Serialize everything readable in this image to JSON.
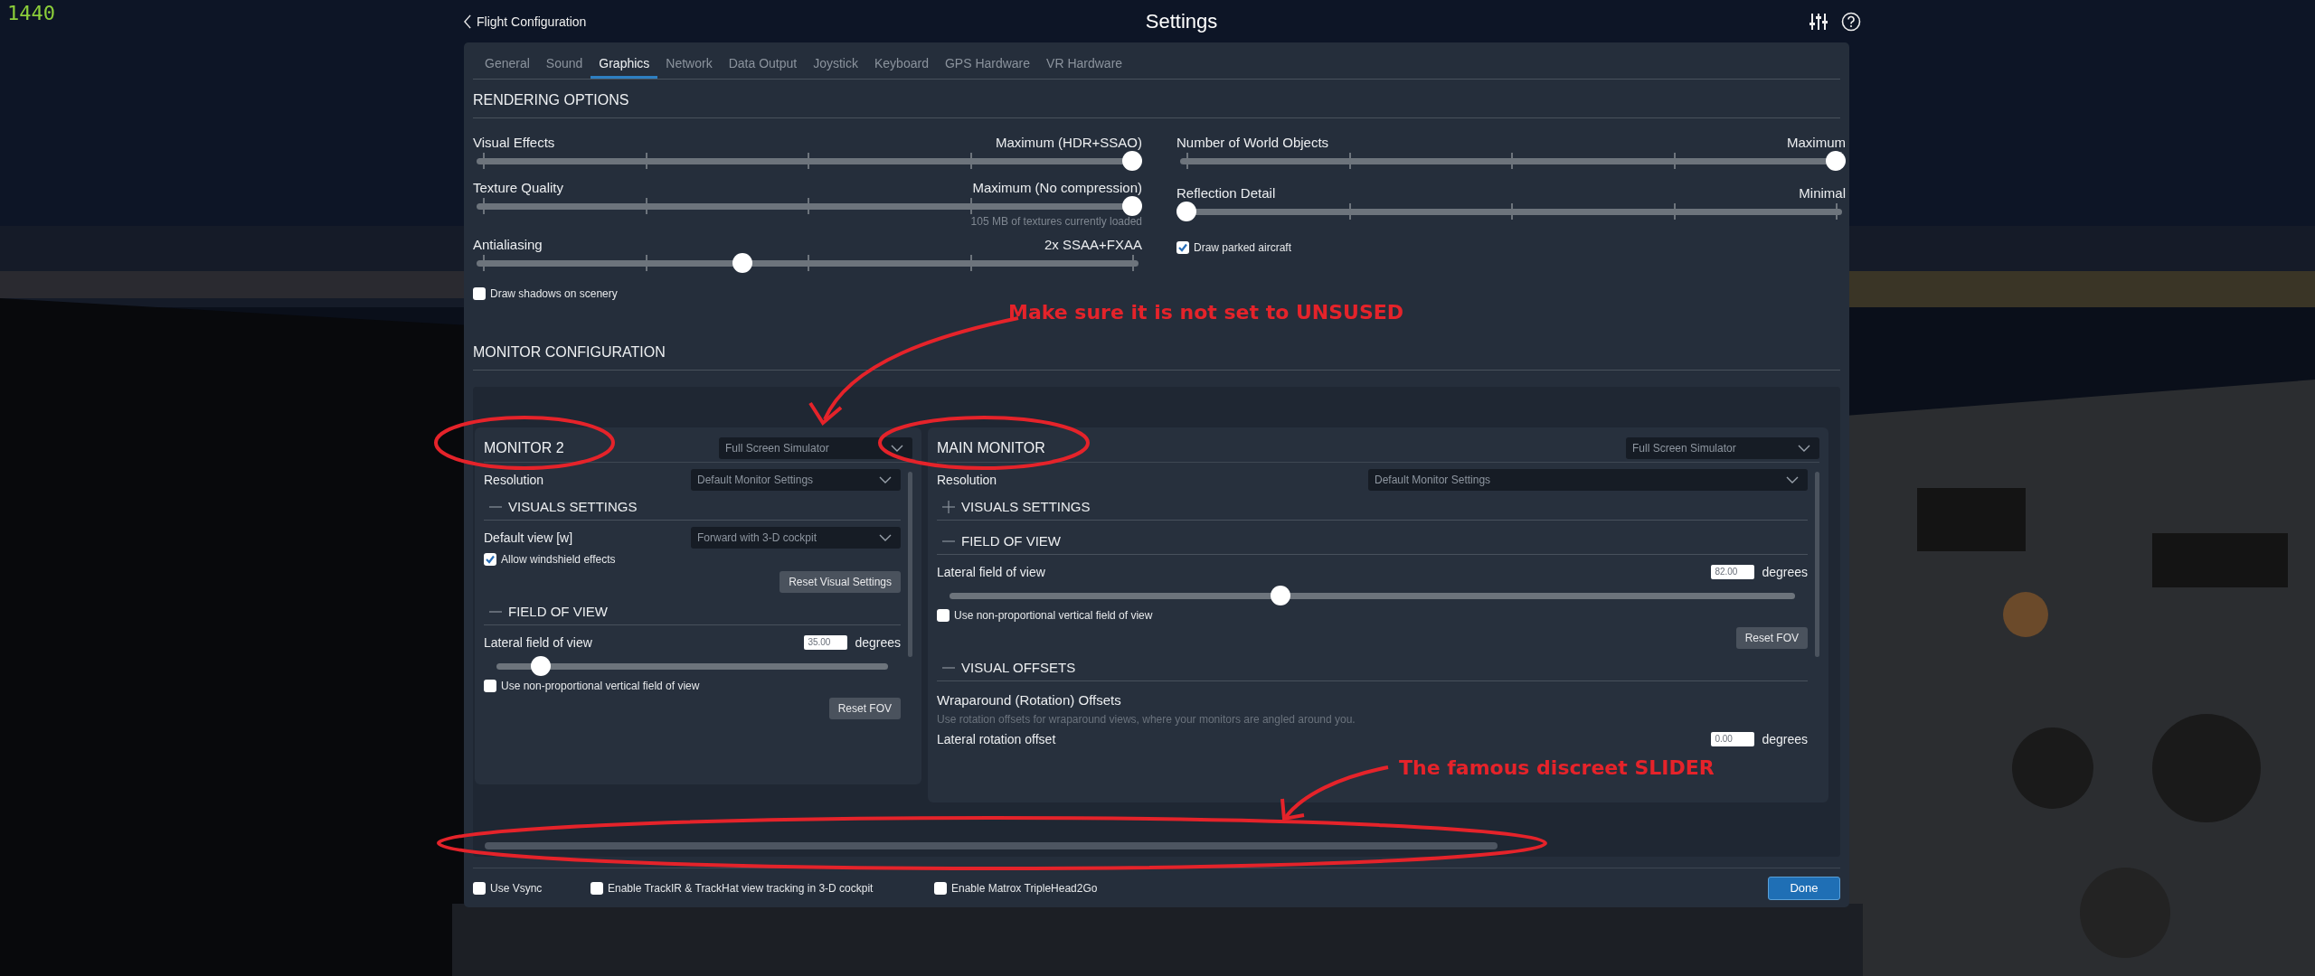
{
  "fps_counter": "1440",
  "header": {
    "back_link": "Flight Configuration",
    "title": "Settings"
  },
  "tabs": [
    {
      "label": "General",
      "selected": false
    },
    {
      "label": "Sound",
      "selected": false
    },
    {
      "label": "Graphics",
      "selected": true
    },
    {
      "label": "Network",
      "selected": false
    },
    {
      "label": "Data Output",
      "selected": false
    },
    {
      "label": "Joystick",
      "selected": false
    },
    {
      "label": "Keyboard",
      "selected": false
    },
    {
      "label": "GPS Hardware",
      "selected": false
    },
    {
      "label": "VR Hardware",
      "selected": false
    }
  ],
  "rendering": {
    "title": "RENDERING OPTIONS",
    "left": [
      {
        "kind": "slider",
        "label": "Visual Effects",
        "value": "Maximum (HDR+SSAO)",
        "level": 1
      },
      {
        "kind": "slider",
        "label": "Texture Quality",
        "value": "Maximum (No compression)",
        "level": 1,
        "note": "105 MB of textures currently loaded"
      },
      {
        "kind": "slider",
        "label": "Antialiasing",
        "value": "2x SSAA+FXAA",
        "level": 0.4
      },
      {
        "kind": "checkbox",
        "label": "Draw shadows on scenery",
        "checked": false
      }
    ],
    "right": [
      {
        "kind": "slider",
        "label": "Number of World Objects",
        "value": "Maximum",
        "level": 1
      },
      {
        "kind": "slider",
        "label": "Reflection Detail",
        "value": "Minimal",
        "level": 0
      },
      {
        "kind": "checkbox",
        "label": "Draw parked aircraft",
        "checked": true
      }
    ]
  },
  "monitor_configuration": {
    "title": "MONITOR CONFIGURATION",
    "monitors": [
      {
        "title": "MONITOR 2",
        "mode": "Full Screen Simulator",
        "items": [
          {
            "kind": "dropdown",
            "label": "Resolution",
            "value": "Default Monitor Settings"
          },
          {
            "kind": "section",
            "label": "VISUALS SETTINGS",
            "expanded": true
          },
          {
            "kind": "dropdown",
            "label": "Default view [w]",
            "value": "Forward with 3-D cockpit"
          },
          {
            "kind": "checkbox",
            "label": "Allow windshield effects",
            "checked": true
          },
          {
            "kind": "button",
            "label": "Reset Visual Settings"
          },
          {
            "kind": "section",
            "label": "FIELD OF VIEW",
            "expanded": true
          },
          {
            "kind": "fov",
            "label": "Lateral field of view",
            "value": "35.00",
            "unit": "degrees",
            "level": 0.1
          },
          {
            "kind": "checkbox",
            "label": "Use non-proportional vertical field of view",
            "checked": false
          },
          {
            "kind": "button",
            "label": "Reset FOV"
          }
        ]
      },
      {
        "title": "MAIN MONITOR",
        "mode": "Full Screen Simulator",
        "items": [
          {
            "kind": "dropdown",
            "label": "Resolution",
            "value": "Default Monitor Settings"
          },
          {
            "kind": "section",
            "label": "VISUALS SETTINGS",
            "expanded": false
          },
          {
            "kind": "section",
            "label": "FIELD OF VIEW",
            "expanded": true
          },
          {
            "kind": "fov",
            "label": "Lateral field of view",
            "value": "82.00",
            "unit": "degrees",
            "level": 0.39
          },
          {
            "kind": "checkbox",
            "label": "Use non-proportional vertical field of view",
            "checked": false
          },
          {
            "kind": "button",
            "label": "Reset FOV"
          },
          {
            "kind": "section",
            "label": "VISUAL OFFSETS",
            "expanded": true
          },
          {
            "kind": "heading",
            "label": "Wraparound (Rotation) Offsets"
          },
          {
            "kind": "hint",
            "label": "Use rotation offsets for wraparound views, where your monitors are angled around you."
          },
          {
            "kind": "offset",
            "label": "Lateral rotation offset",
            "value": "0.00",
            "unit": "degrees"
          }
        ]
      }
    ]
  },
  "footer": {
    "options": [
      {
        "label": "Use Vsync",
        "checked": false
      },
      {
        "label": "Enable TrackIR & TrackHat view tracking in 3-D cockpit",
        "checked": false
      },
      {
        "label": "Enable Matrox TripleHead2Go",
        "checked": false
      }
    ],
    "done_button": "Done"
  },
  "annotations": [
    {
      "text": "Make sure it is not set to UNSUSED"
    },
    {
      "text": "The famous discreet SLIDER"
    }
  ]
}
